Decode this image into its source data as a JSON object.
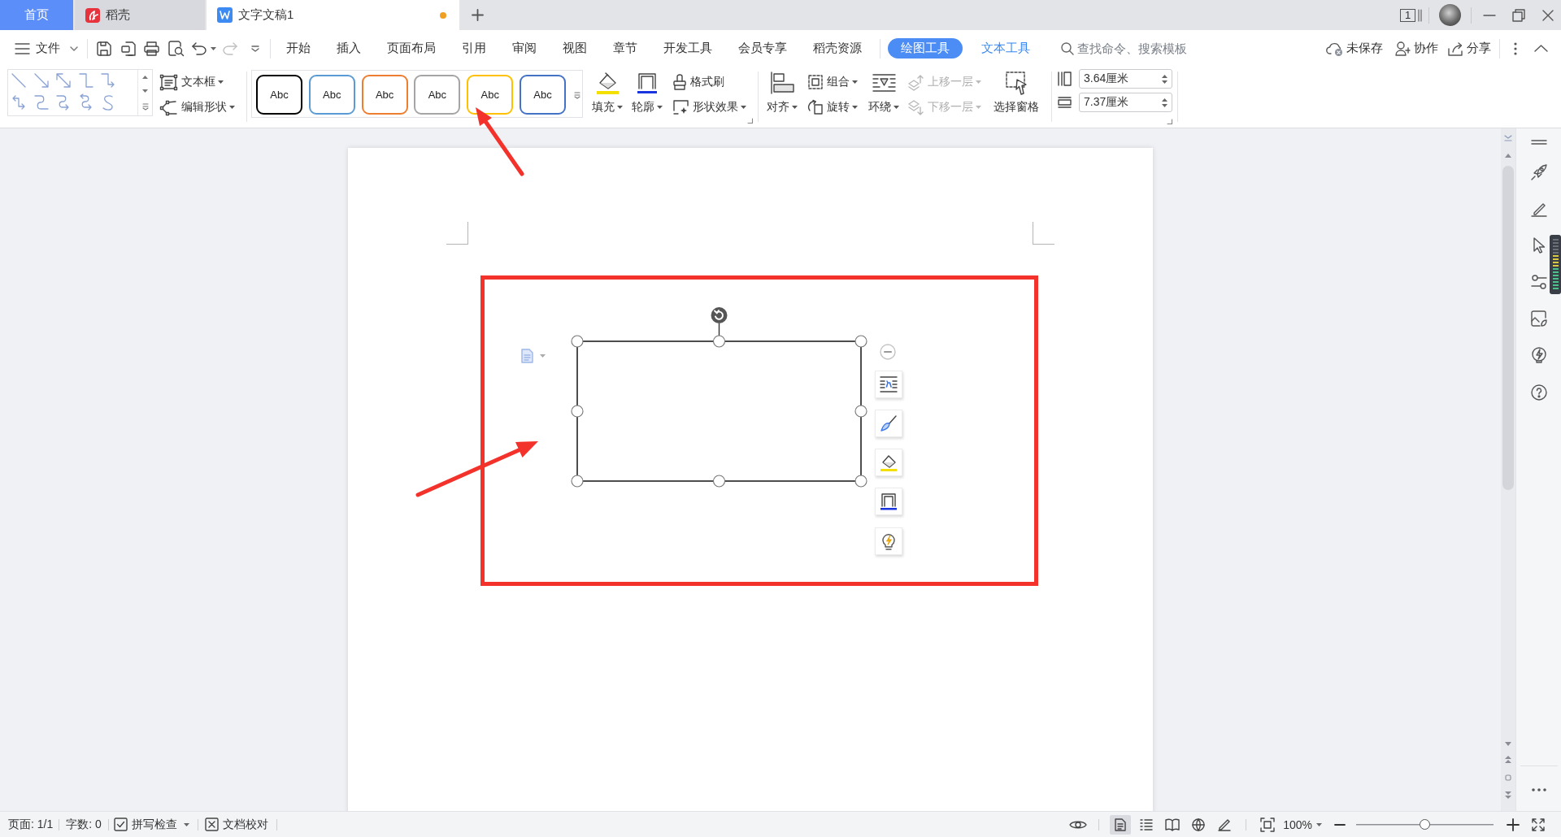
{
  "title_bar": {
    "tabs": [
      {
        "kind": "home",
        "label": "首页",
        "selected": false
      },
      {
        "kind": "app",
        "label": "稻壳",
        "selected": false
      },
      {
        "kind": "document",
        "label": "文字文稿1",
        "selected": true,
        "modified": true
      }
    ],
    "window_count": "1"
  },
  "menu_bar": {
    "file_menu": "文件",
    "quick_access": [
      {
        "kind": "save",
        "disabled": false
      },
      {
        "kind": "export",
        "disabled": false
      },
      {
        "kind": "print",
        "disabled": false
      },
      {
        "kind": "preview",
        "disabled": false
      },
      {
        "kind": "undo",
        "disabled": false
      },
      {
        "kind": "redo",
        "disabled": true
      }
    ],
    "tabs": [
      {
        "label": "开始",
        "selected": false,
        "contextual": false
      },
      {
        "label": "插入",
        "selected": false,
        "contextual": false
      },
      {
        "label": "页面布局",
        "selected": false,
        "contextual": false
      },
      {
        "label": "引用",
        "selected": false,
        "contextual": false
      },
      {
        "label": "审阅",
        "selected": false,
        "contextual": false
      },
      {
        "label": "视图",
        "selected": false,
        "contextual": false
      },
      {
        "label": "章节",
        "selected": false,
        "contextual": false
      },
      {
        "label": "开发工具",
        "selected": false,
        "contextual": false
      },
      {
        "label": "会员专享",
        "selected": false,
        "contextual": false
      },
      {
        "label": "稻壳资源",
        "selected": false,
        "contextual": false
      },
      {
        "label": "绘图工具",
        "selected": true,
        "contextual": true
      },
      {
        "label": "文本工具",
        "selected": false,
        "contextual": true
      }
    ],
    "search": {
      "placeholder": "查找命令、搜索模板"
    },
    "actions": [
      {
        "kind": "cloud",
        "label": "未保存"
      },
      {
        "kind": "collaborate",
        "label": "协作"
      },
      {
        "kind": "share",
        "label": "分享"
      }
    ]
  },
  "ribbon": {
    "insert_buttons": [
      "文本框",
      "编辑形状"
    ],
    "styles": [
      {
        "label": "Abc",
        "color": "#000000"
      },
      {
        "label": "Abc",
        "color": "#5b9bd5"
      },
      {
        "label": "Abc",
        "color": "#ed7d31"
      },
      {
        "label": "Abc",
        "color": "#a5a5a5"
      },
      {
        "label": "Abc",
        "color": "#ffc000"
      },
      {
        "label": "Abc",
        "color": "#4472c4"
      }
    ],
    "format_buttons": [
      "填充",
      "轮廓",
      "格式刷",
      "形状效果"
    ],
    "arrange_buttons": [
      {
        "label": "对齐",
        "disabled": false
      },
      {
        "label": "组合",
        "disabled": false
      },
      {
        "label": "旋转",
        "disabled": false
      },
      {
        "label": "环绕",
        "disabled": false
      },
      {
        "label": "上移一层",
        "disabled": true
      },
      {
        "label": "下移一层",
        "disabled": true
      },
      {
        "label": "选择窗格",
        "disabled": false
      }
    ],
    "size_fields": [
      {
        "kind": "height",
        "value": "3.64厘米"
      },
      {
        "kind": "width",
        "value": "7.37厘米"
      }
    ]
  },
  "canvas": {
    "shape": {
      "selected": true
    }
  },
  "status_bar": {
    "page": "页面: 1/1",
    "word_count": "字数: 0",
    "spell_check": "拼写检查",
    "proofread": "文档校对",
    "views": [
      {
        "kind": "page",
        "selected": true
      },
      {
        "kind": "outline",
        "selected": false
      },
      {
        "kind": "reading",
        "selected": false
      },
      {
        "kind": "web",
        "selected": false
      },
      {
        "kind": "writing",
        "selected": false
      }
    ],
    "zoom": "100%",
    "zoom_slider": {
      "level": 0.5
    }
  }
}
